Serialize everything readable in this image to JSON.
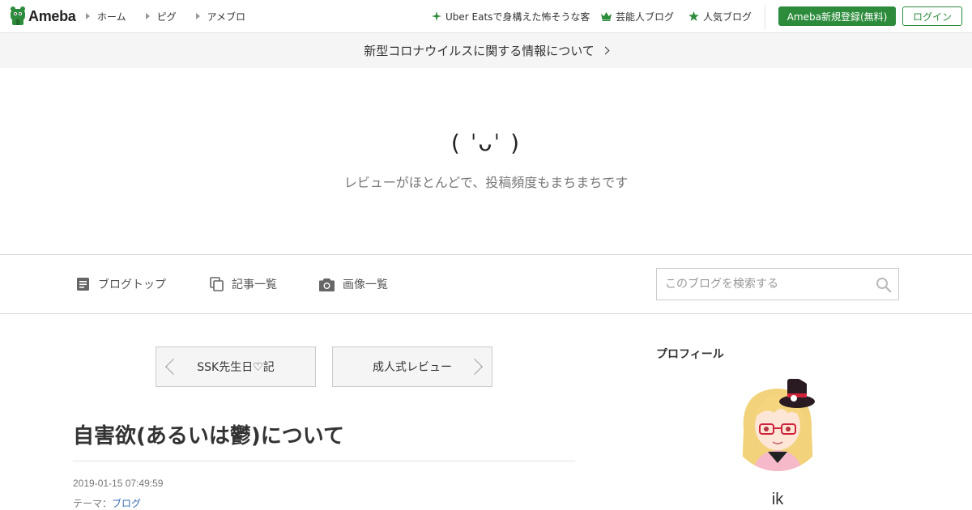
{
  "header": {
    "logo_text": "Ameba",
    "nav": [
      {
        "label": "ホーム"
      },
      {
        "label": "ピグ"
      },
      {
        "label": "アメブロ"
      }
    ],
    "promos": [
      {
        "label": "Uber Eatsで身構えた怖そうな客",
        "icon": "sparkle-icon"
      },
      {
        "label": "芸能人ブログ",
        "icon": "crown-icon"
      },
      {
        "label": "人気ブログ",
        "icon": "star-icon"
      }
    ],
    "register_label": "Ameba新規登録(無料)",
    "login_label": "ログイン",
    "accent_color": "#2d8c3c"
  },
  "notice": {
    "text": "新型コロナウイルスに関する情報について"
  },
  "blog": {
    "face": "( ˈᴗˈ )",
    "description": "レビューがほとんどで、投稿頻度もまちまちです"
  },
  "blognav": {
    "items": [
      {
        "label": "ブログトップ",
        "icon": "document-icon"
      },
      {
        "label": "記事一覧",
        "icon": "copy-icon"
      },
      {
        "label": "画像一覧",
        "icon": "camera-icon"
      }
    ],
    "search_placeholder": "このブログを検索する"
  },
  "pager": {
    "prev_label": "SSK先生日♡記",
    "next_label": "成人式レビュー"
  },
  "article": {
    "title": "自害欲(あるいは鬱)について",
    "date": "2019-01-15 07:49:59",
    "theme_prefix": "テーマ：",
    "theme_link": "ブログ"
  },
  "sidebar": {
    "heading": "プロフィール",
    "profile_name": "ik"
  }
}
